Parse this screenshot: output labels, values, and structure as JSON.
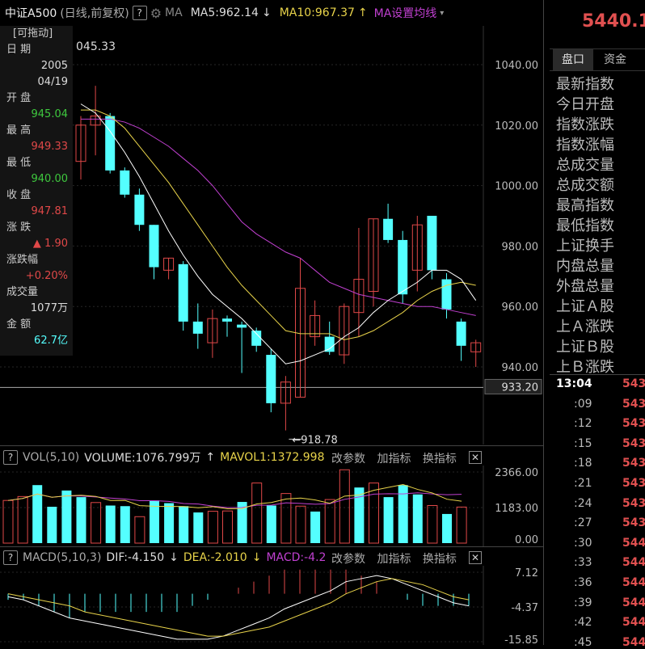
{
  "header": {
    "name": "中证A500",
    "mode": "(日线,前复权)",
    "help": "?",
    "ma_label": "MA",
    "ma5": "MA5:962.14",
    "ma5_arrow": "↓",
    "ma10": "MA10:967.37",
    "ma10_arrow": "↑",
    "ma_set": "MA设置均线",
    "ma_caret": "▾"
  },
  "infopanel": {
    "drag": "[可拖动]",
    "date_label": "日 期",
    "date_year": "2005",
    "date_md": "04/19",
    "open_label": "开 盘",
    "open_val": "945.04",
    "high_label": "最 高",
    "high_val": "949.33",
    "low_label": "最 低",
    "low_val": "940.00",
    "close_label": "收 盘",
    "close_val": "947.81",
    "change_label": "涨 跌",
    "change_val": "▲ 1.90",
    "pct_label": "涨跌幅",
    "pct_val": "+0.20%",
    "vol_label": "成交量",
    "vol_val": "1077万",
    "amount_label": "金 额",
    "amount_val": "62.7亿"
  },
  "main_chart": {
    "top_label": "045.33",
    "low_marker": "918.78",
    "y_ticks": [
      "1040.00",
      "1020.00",
      "1000.00",
      "980.00",
      "960.00",
      "940.00"
    ],
    "current_price": "933.20",
    "colors": {
      "up": "#e04848",
      "down": "#54ffff",
      "ma5": "#ffffff",
      "ma10": "#e8d34a",
      "ma20": "#c040d0"
    }
  },
  "chart_data": {
    "type": "candlestick",
    "title": "中证A500",
    "ylim": [
      918.78,
      1045.33
    ],
    "candles": [
      {
        "o": 1008,
        "h": 1023,
        "l": 1002,
        "c": 1020
      },
      {
        "o": 1020,
        "h": 1033,
        "l": 1010,
        "c": 1023
      },
      {
        "o": 1023,
        "h": 1024,
        "l": 1004,
        "c": 1005
      },
      {
        "o": 1005,
        "h": 1006,
        "l": 996,
        "c": 997
      },
      {
        "o": 997,
        "h": 999,
        "l": 985,
        "c": 987
      },
      {
        "o": 987,
        "h": 987,
        "l": 969,
        "c": 973
      },
      {
        "o": 972,
        "h": 976,
        "l": 969,
        "c": 976
      },
      {
        "o": 974,
        "h": 975,
        "l": 952,
        "c": 955
      },
      {
        "o": 955,
        "h": 961,
        "l": 946,
        "c": 951
      },
      {
        "o": 948,
        "h": 959,
        "l": 943,
        "c": 956
      },
      {
        "o": 956,
        "h": 957,
        "l": 950,
        "c": 955
      },
      {
        "o": 954,
        "h": 955,
        "l": 938,
        "c": 953
      },
      {
        "o": 952,
        "h": 953,
        "l": 945,
        "c": 947
      },
      {
        "o": 944,
        "h": 946,
        "l": 925,
        "c": 928
      },
      {
        "o": 928,
        "h": 937,
        "l": 919,
        "c": 935
      },
      {
        "o": 930,
        "h": 976,
        "l": 930,
        "c": 966
      },
      {
        "o": 950,
        "h": 962,
        "l": 947,
        "c": 957
      },
      {
        "o": 950,
        "h": 955,
        "l": 944,
        "c": 945
      },
      {
        "o": 944,
        "h": 961,
        "l": 941,
        "c": 960
      },
      {
        "o": 958,
        "h": 986,
        "l": 950,
        "c": 969
      },
      {
        "o": 965,
        "h": 989,
        "l": 960,
        "c": 989
      },
      {
        "o": 989,
        "h": 994,
        "l": 981,
        "c": 982
      },
      {
        "o": 982,
        "h": 985,
        "l": 961,
        "c": 964
      },
      {
        "o": 972,
        "h": 990,
        "l": 965,
        "c": 987
      },
      {
        "o": 990,
        "h": 990,
        "l": 969,
        "c": 972
      },
      {
        "o": 969,
        "h": 971,
        "l": 956,
        "c": 959
      },
      {
        "o": 955,
        "h": 956,
        "l": 942,
        "c": 947
      },
      {
        "o": 945,
        "h": 949,
        "l": 940,
        "c": 948
      }
    ],
    "ma5": [
      1027,
      1024,
      1018,
      1011,
      1003,
      994,
      985,
      977,
      970,
      964,
      960,
      956,
      951,
      946,
      941,
      942,
      944,
      946,
      950,
      953,
      958,
      962,
      965,
      968,
      972,
      972,
      969,
      962
    ],
    "ma10": [
      1025,
      1025,
      1023,
      1019,
      1013,
      1007,
      1001,
      994,
      987,
      980,
      973,
      967,
      962,
      957,
      952,
      951,
      951,
      951,
      949,
      950,
      952,
      955,
      958,
      962,
      965,
      967,
      968,
      967
    ],
    "ma20": [
      1022,
      1022,
      1022,
      1021,
      1019,
      1016,
      1013,
      1009,
      1005,
      1000,
      994,
      988,
      984,
      981,
      978,
      976,
      972,
      968,
      966,
      964,
      963,
      962,
      961,
      960,
      960,
      959,
      958,
      957
    ],
    "volume": {
      "title": "VOL(5,10)",
      "volume_label": "VOLUME:1076.799万",
      "volume_arrow": "↑",
      "mavol1_label": "MAVOL1:1372.998",
      "y_ticks": [
        "2366.00",
        "1183.00",
        "0.00"
      ],
      "ylim": [
        0,
        2366
      ],
      "values": [
        1420,
        1550,
        1930,
        1210,
        1750,
        1530,
        1350,
        1250,
        1230,
        880,
        1420,
        1330,
        1230,
        1020,
        1060,
        1070,
        1370,
        2000,
        1250,
        1650,
        1230,
        1050,
        1450,
        2440,
        1850,
        2000,
        1530,
        1930,
        1620,
        1250,
        970,
        1200
      ]
    },
    "macd": {
      "title": "MACD(5,10,3)",
      "dif_label": "DIF:-4.150",
      "dif_arrow": "↓",
      "dea_label": "DEA:-2.010",
      "dea_arrow": "↓",
      "macd_label": "MACD:-4.2",
      "y_ticks": [
        "7.12",
        "-4.37",
        "-15.85"
      ],
      "ylim": [
        -15.85,
        7.12
      ]
    }
  },
  "volume_buttons": {
    "change": "改参数",
    "add": "加指标",
    "switch": "换指标",
    "close": "✕"
  },
  "macd_buttons": {
    "change": "改参数",
    "add": "加指标",
    "switch": "换指标",
    "close": "✕"
  },
  "right_panel": {
    "price": "5440.1",
    "tab1": "盘口",
    "tab2": "资金",
    "items": [
      "最新指数",
      "今日开盘",
      "指数涨跌",
      "指数涨幅",
      "总成交量",
      "总成交额",
      "最高指数",
      "最低指数",
      "上证换手",
      "内盘总量",
      "外盘总量",
      "上证Ａ股",
      "上Ａ涨跌",
      "上证Ｂ股",
      "上Ｂ涨跌"
    ],
    "times": [
      "13:04",
      ":09",
      ":12",
      ":15",
      ":18",
      ":21",
      ":24",
      ":27",
      ":30",
      ":33",
      ":36",
      ":39",
      ":42",
      ":45"
    ],
    "prices": [
      "543",
      "543",
      "543",
      "543",
      "543",
      "543",
      "543",
      "543",
      "544",
      "544",
      "544",
      "544",
      "544",
      "544"
    ]
  }
}
